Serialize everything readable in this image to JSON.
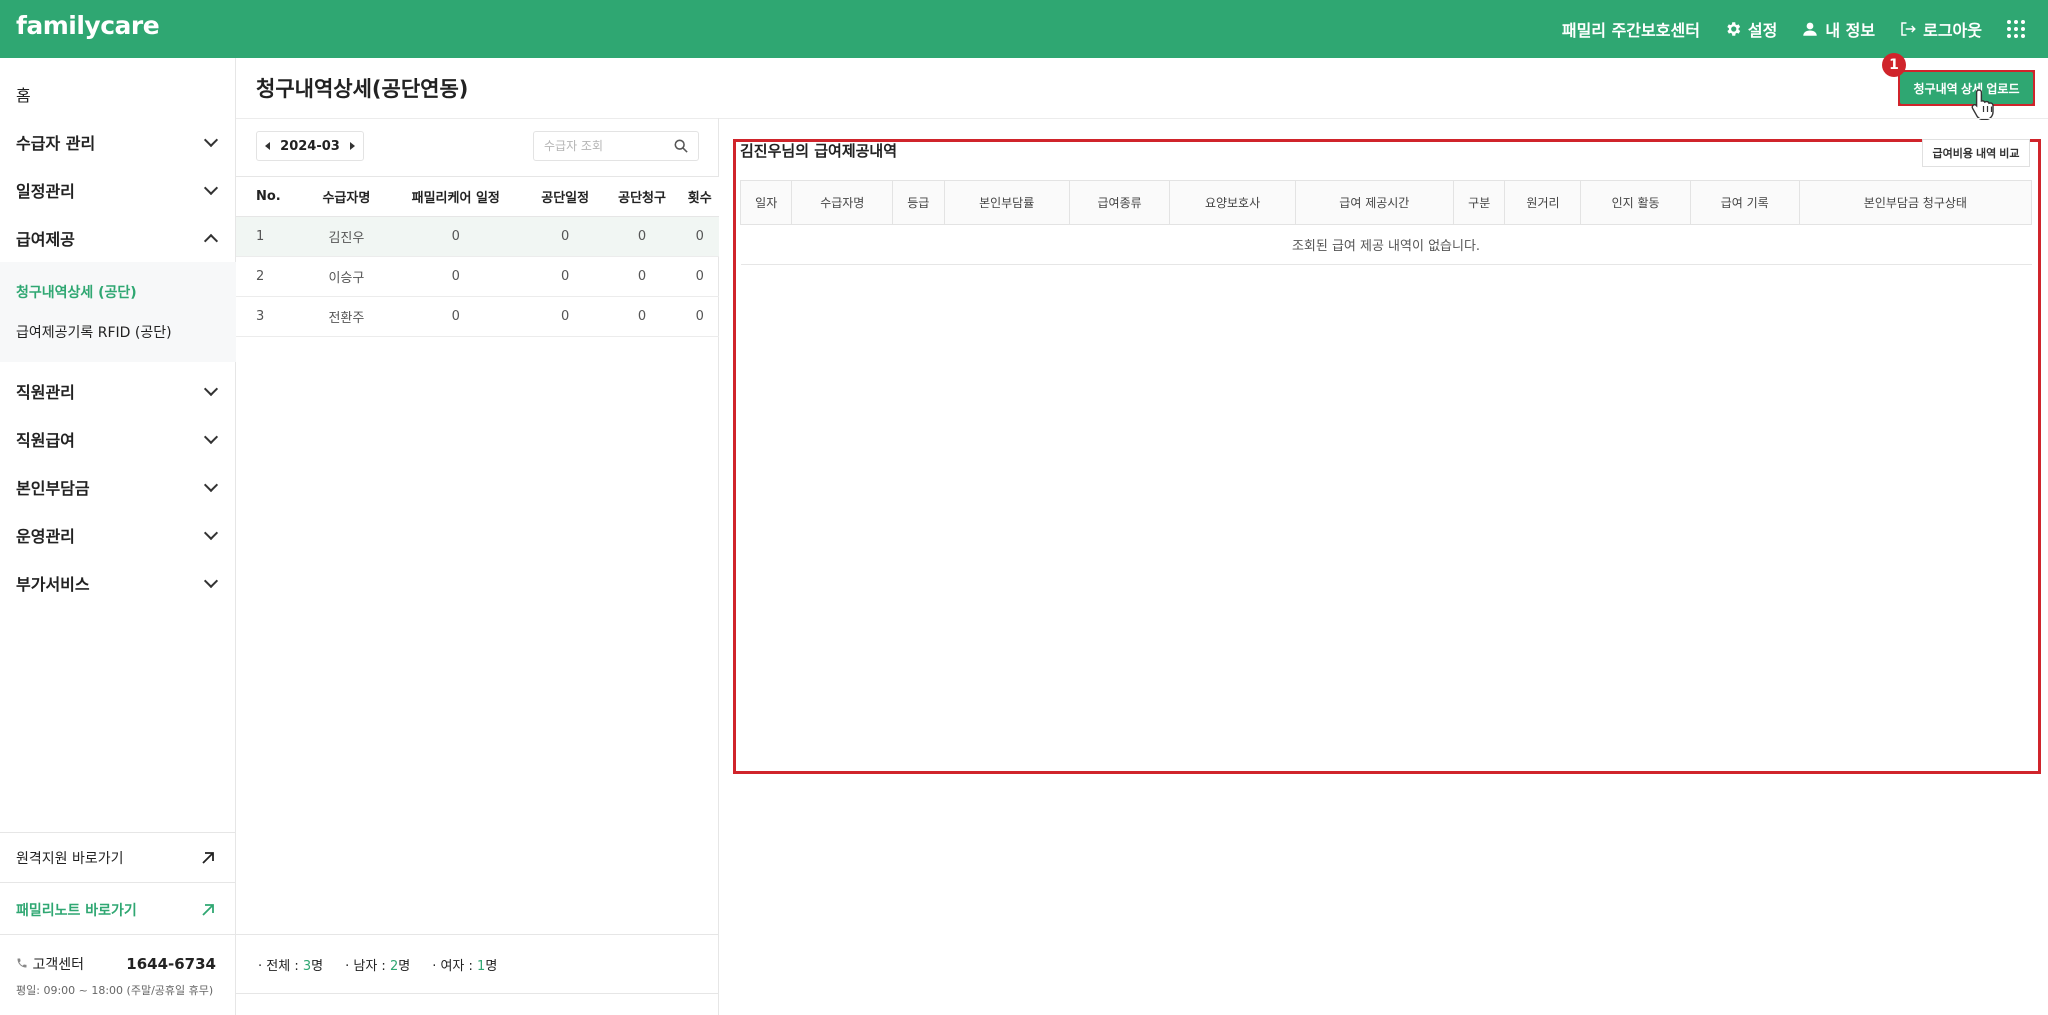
{
  "app": {
    "logo": "familycare",
    "center_name": "패밀리 주간보호센터",
    "settings_label": "설정",
    "myinfo_label": "내 정보",
    "logout_label": "로그아웃"
  },
  "sidebar": {
    "home": "홈",
    "items": [
      {
        "label": "수급자 관리"
      },
      {
        "label": "일정관리"
      },
      {
        "label": "급여제공"
      }
    ],
    "sub_items": [
      {
        "label": "청구내역상세 (공단)"
      },
      {
        "label": "급여제공기록 RFID (공단)"
      }
    ],
    "items2": [
      {
        "label": "직원관리"
      },
      {
        "label": "직원급여"
      },
      {
        "label": "본인부담금"
      },
      {
        "label": "운영관리"
      },
      {
        "label": "부가서비스"
      }
    ],
    "remote_link": "원격지원 바로가기",
    "note_link": "패밀리노트 바로가기",
    "cs_label": "고객센터",
    "cs_phone": "1644-6734",
    "cs_hours": "평일: 09:00 ~ 18:00 (주말/공휴일 휴무)"
  },
  "page": {
    "title": "청구내역상세(공단연동)",
    "upload_button": "청구내역 상세 업로드",
    "badge": "1"
  },
  "left": {
    "month": "2024-03",
    "search_placeholder": "수급자 조회",
    "columns": [
      "No.",
      "수급자명",
      "패밀리케어 일정",
      "공단일정",
      "공단청구",
      "횟수"
    ],
    "rows": [
      [
        "1",
        "김진우",
        "0",
        "0",
        "0",
        "0"
      ],
      [
        "2",
        "이승구",
        "0",
        "0",
        "0",
        "0"
      ],
      [
        "3",
        "전환주",
        "0",
        "0",
        "0",
        "0"
      ]
    ],
    "summary": {
      "total_label": "· 전체 :",
      "total_value": "3",
      "male_label": "· 남자 :",
      "male_value": "2",
      "female_label": "· 여자 :",
      "female_value": "1",
      "unit": "명"
    }
  },
  "detail": {
    "title": "김진우님의 급여제공내역",
    "compare_button": "급여비용 내역 비교",
    "columns": [
      "일자",
      "수급자명",
      "등급",
      "본인부담률",
      "급여종류",
      "요양보호사",
      "급여 제공시간",
      "구분",
      "원거리",
      "인지 활동",
      "급여 기록",
      "본인부담금 청구상태"
    ],
    "empty_message": "조회된 급여 제공 내역이 없습니다."
  },
  "colors": {
    "brand": "#2fa772",
    "highlight": "#d0242b"
  }
}
